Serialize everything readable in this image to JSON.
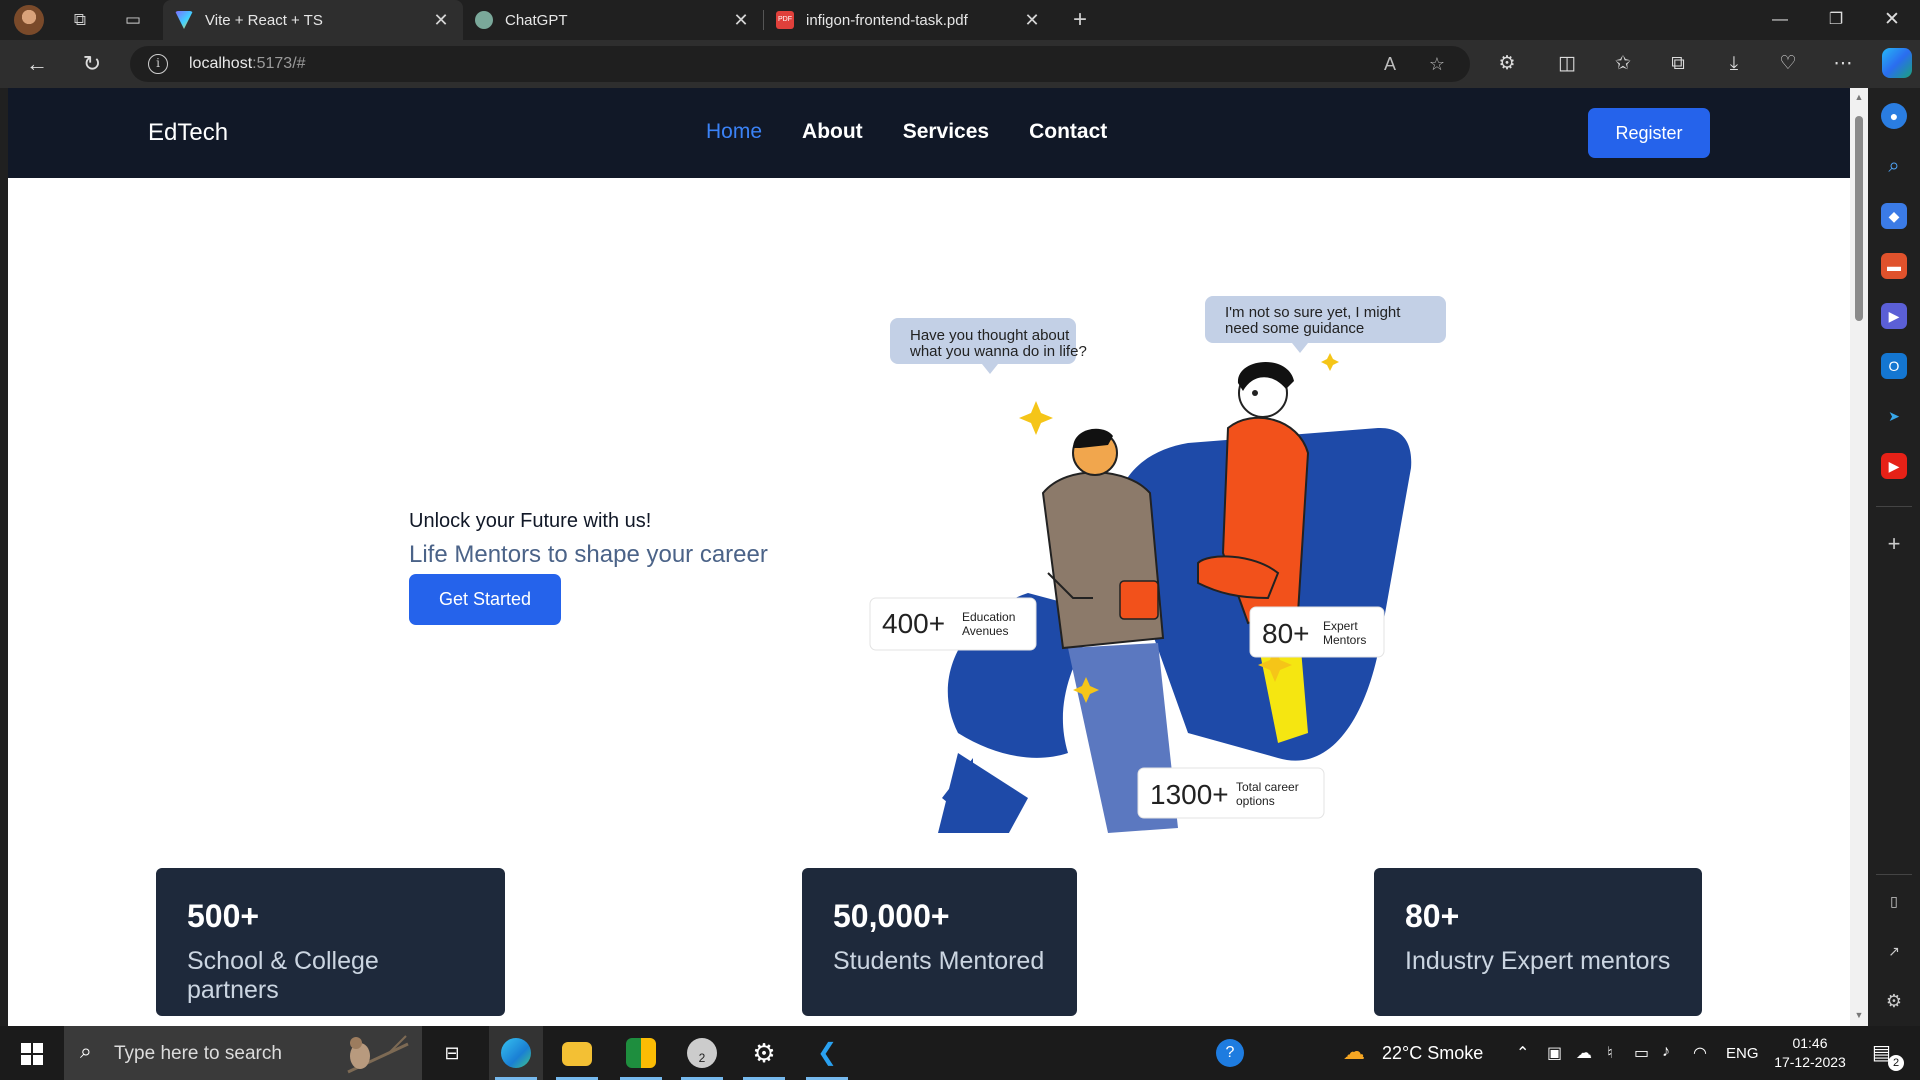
{
  "browser": {
    "tabs": [
      {
        "title": "Vite + React + TS",
        "active": true
      },
      {
        "title": "ChatGPT",
        "active": false
      },
      {
        "title": "infigon-frontend-task.pdf",
        "active": false
      }
    ],
    "url_host": "localhost",
    "url_rest": ":5173/#"
  },
  "site": {
    "brand": "EdTech",
    "nav": [
      "Home",
      "About",
      "Services",
      "Contact"
    ],
    "register_label": "Register"
  },
  "hero": {
    "eyebrow": "Unlock your Future with us!",
    "title": "Life Mentors to shape your career",
    "cta": "Get Started"
  },
  "illustration": {
    "bubble_left": [
      "Have you thought about",
      "what you wanna do in life?"
    ],
    "bubble_right": [
      "I'm not so sure yet, I might",
      "need some guidance"
    ],
    "badges": [
      {
        "num": "400+",
        "label": [
          "Education",
          "Avenues"
        ]
      },
      {
        "num": "80+",
        "label": [
          "Expert",
          "Mentors"
        ]
      },
      {
        "num": "1300+",
        "label": [
          "Total career",
          "options"
        ]
      }
    ]
  },
  "stats": [
    {
      "value": "500+",
      "label": "School & College partners"
    },
    {
      "value": "50,000+",
      "label": "Students Mentored"
    },
    {
      "value": "80+",
      "label": "Industry Expert mentors"
    }
  ],
  "taskbar": {
    "search_placeholder": "Type here to search",
    "weather": "22°C  Smoke",
    "language": "ENG",
    "time": "01:46",
    "date": "17-12-2023",
    "notification_count": "2",
    "chrome_badge": "2"
  },
  "colors": {
    "nav_bg": "#111827",
    "accent": "#2563eb",
    "active_link": "#3b82f6",
    "card_bg": "#1e293b",
    "illus_blue": "#1e4aa8",
    "illus_orange": "#f2511b",
    "illus_yellow": "#f5e611"
  }
}
